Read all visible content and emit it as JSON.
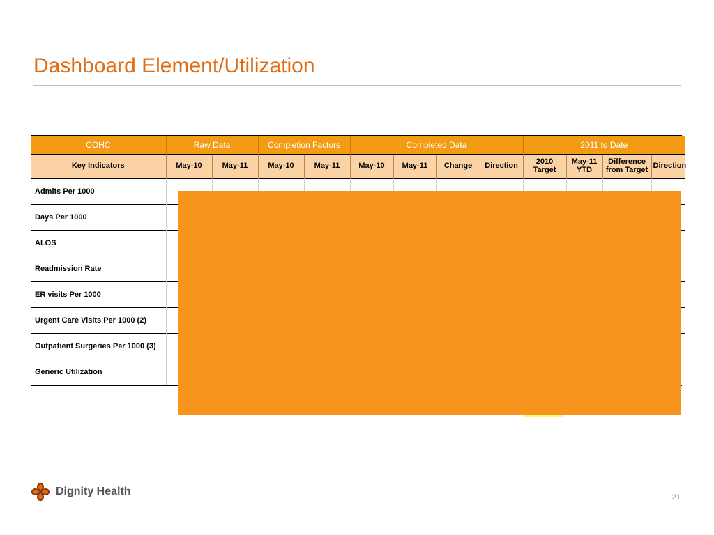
{
  "title": "Dashboard Element/Utilization",
  "table": {
    "group_headers": {
      "key": "COHC",
      "raw_data": "Raw Data",
      "completion_factors": "Completion Factors",
      "completed_data": "Completed Data",
      "to_date": "2011 to Date"
    },
    "col_headers": {
      "key": "Key Indicators",
      "raw_may10": "May-10",
      "raw_may11": "May-11",
      "cf_may10": "May-10",
      "cf_may11": "May-11",
      "cd_may10": "May-10",
      "cd_may11": "May-11",
      "cd_change": "Change",
      "cd_direction": "Direction",
      "y_target": "2010 Target",
      "y_ytd_top": "May-11",
      "y_ytd_bot": "YTD",
      "y_diff_top": "Difference",
      "y_diff_bot": "from Target",
      "y_direction": "Direction"
    },
    "rows": [
      "Admits Per 1000",
      "Days Per 1000",
      "ALOS",
      "Readmission Rate",
      "ER visits Per 1000",
      "Urgent Care Visits Per 1000 (2)",
      "Outpatient Surgeries Per 1000 (3)",
      "Generic Utilization"
    ]
  },
  "footer": {
    "brand": "Dignity Health",
    "page": "21"
  },
  "colors": {
    "title": "#e06c12",
    "header_bg": "#f39b12",
    "subheader_bg": "#fbd3a5",
    "overlay": "#f7941d",
    "highlight": "#fff77a"
  }
}
